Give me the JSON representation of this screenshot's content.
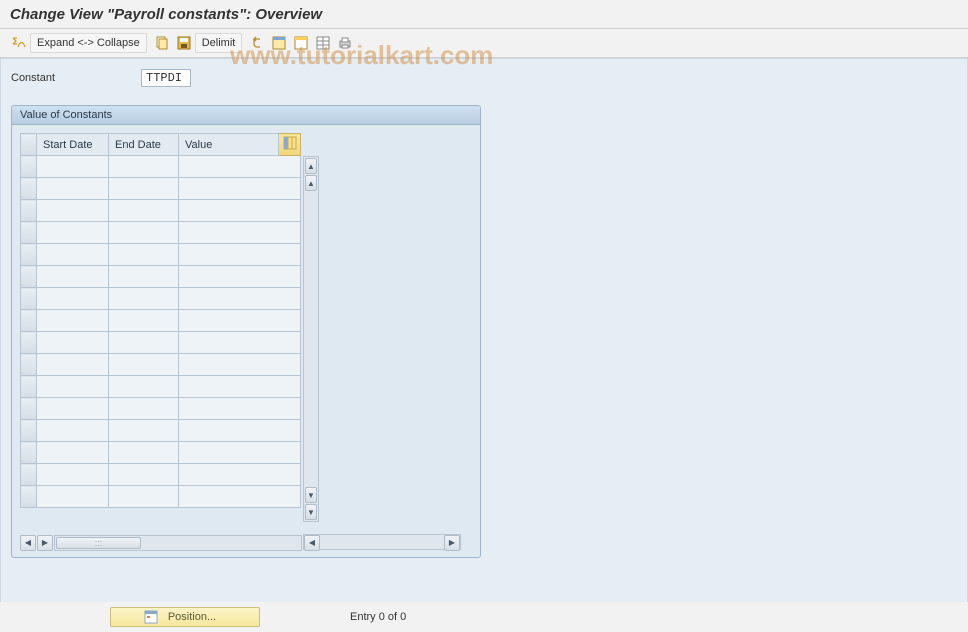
{
  "header": {
    "title": "Change View \"Payroll constants\": Overview"
  },
  "toolbar": {
    "expand_collapse_label": "Expand <-> Collapse",
    "delimit_label": "Delimit"
  },
  "field": {
    "constant_label": "Constant",
    "constant_value": "TTPDI"
  },
  "panel": {
    "title": "Value of Constants",
    "columns": {
      "start": "Start Date",
      "end": "End Date",
      "value": "Value"
    },
    "rows": [
      {
        "start": "",
        "end": "",
        "value": ""
      },
      {
        "start": "",
        "end": "",
        "value": ""
      },
      {
        "start": "",
        "end": "",
        "value": ""
      },
      {
        "start": "",
        "end": "",
        "value": ""
      },
      {
        "start": "",
        "end": "",
        "value": ""
      },
      {
        "start": "",
        "end": "",
        "value": ""
      },
      {
        "start": "",
        "end": "",
        "value": ""
      },
      {
        "start": "",
        "end": "",
        "value": ""
      },
      {
        "start": "",
        "end": "",
        "value": ""
      },
      {
        "start": "",
        "end": "",
        "value": ""
      },
      {
        "start": "",
        "end": "",
        "value": ""
      },
      {
        "start": "",
        "end": "",
        "value": ""
      },
      {
        "start": "",
        "end": "",
        "value": ""
      },
      {
        "start": "",
        "end": "",
        "value": ""
      },
      {
        "start": "",
        "end": "",
        "value": ""
      },
      {
        "start": "",
        "end": "",
        "value": ""
      }
    ]
  },
  "footer": {
    "position_label": "Position...",
    "entry_text": "Entry 0 of 0"
  },
  "watermark": "www.tutorialkart.com"
}
